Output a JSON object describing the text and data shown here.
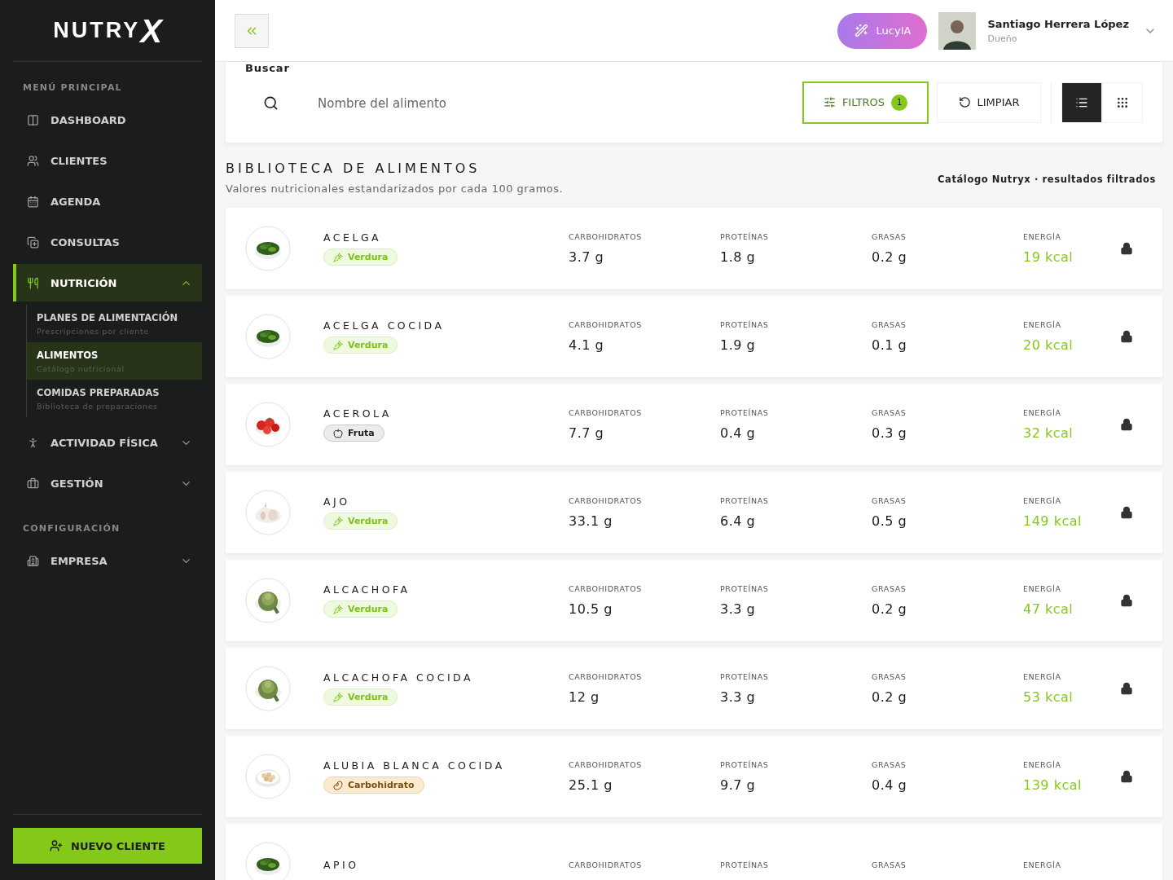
{
  "sidebar": {
    "logo": "NUTRY",
    "logo_mark": "X",
    "sections": [
      {
        "title": "MENÚ PRINCIPAL",
        "items": [
          {
            "label": "DASHBOARD",
            "selected": false
          },
          {
            "label": "CLIENTES",
            "selected": false
          },
          {
            "label": "AGENDA",
            "selected": false
          },
          {
            "label": "CONSULTAS",
            "selected": false
          },
          {
            "label": "NUTRICIÓN",
            "selected": true,
            "expanded": true,
            "children": [
              {
                "label": "PLANES DE ALIMENTACIÓN",
                "subtitle": "Prescripciones por cliente",
                "selected": false
              },
              {
                "label": "ALIMENTOS",
                "subtitle": "Catálogo nutricional",
                "selected": true
              },
              {
                "label": "COMIDAS PREPARADAS",
                "subtitle": "Biblioteca de preparaciones",
                "selected": false
              }
            ]
          },
          {
            "label": "ACTIVIDAD FÍSICA",
            "selected": false,
            "expanded": false
          },
          {
            "label": "GESTIÓN",
            "selected": false,
            "expanded": false
          }
        ]
      },
      {
        "title": "CONFIGURACIÓN",
        "items": [
          {
            "label": "EMPRESA",
            "selected": false,
            "expanded": false
          }
        ]
      }
    ],
    "new_button": "NUEVO CLIENTE"
  },
  "topbar": {
    "assistant": "LucyIA",
    "user": {
      "name": "Santiago Herrera López",
      "role": "Dueño"
    }
  },
  "search": {
    "label": "Buscar",
    "placeholder": "Nombre del alimento",
    "filters": {
      "label": "FILTROS",
      "count": "1"
    },
    "clear": "LIMPIAR",
    "views": [
      {
        "kind": "list",
        "selected": true
      },
      {
        "kind": "grid",
        "selected": false
      }
    ]
  },
  "library": {
    "title": "BIBLIOTECA DE ALIMENTOS",
    "subtitle": "Valores nutricionales estandarizados por cada 100 gramos.",
    "note": "Catálogo Nutryx · resultados filtrados",
    "foods": [
      {
        "name": "ACELGA",
        "tag": {
          "label": "Verdura",
          "kind": "vegetable"
        },
        "locked": true,
        "stats": [
          {
            "label": "CARBOHIDRATOS",
            "value": "3.7 g",
            "kind": "mass"
          },
          {
            "label": "PROTEÍNAS",
            "value": "1.8 g",
            "kind": "mass"
          },
          {
            "label": "GRASAS",
            "value": "0.2 g",
            "kind": "mass"
          },
          {
            "label": "ENERGÍA",
            "value": "19 kcal",
            "kind": "energy"
          }
        ]
      },
      {
        "name": "ACELGA COCIDA",
        "tag": {
          "label": "Verdura",
          "kind": "vegetable"
        },
        "locked": true,
        "stats": [
          {
            "label": "CARBOHIDRATOS",
            "value": "4.1 g",
            "kind": "mass"
          },
          {
            "label": "PROTEÍNAS",
            "value": "1.9 g",
            "kind": "mass"
          },
          {
            "label": "GRASAS",
            "value": "0.1 g",
            "kind": "mass"
          },
          {
            "label": "ENERGÍA",
            "value": "20 kcal",
            "kind": "energy"
          }
        ]
      },
      {
        "name": "ACEROLA",
        "tag": {
          "label": "Fruta",
          "kind": "fruit"
        },
        "locked": true,
        "stats": [
          {
            "label": "CARBOHIDRATOS",
            "value": "7.7 g",
            "kind": "mass"
          },
          {
            "label": "PROTEÍNAS",
            "value": "0.4 g",
            "kind": "mass"
          },
          {
            "label": "GRASAS",
            "value": "0.3 g",
            "kind": "mass"
          },
          {
            "label": "ENERGÍA",
            "value": "32 kcal",
            "kind": "energy"
          }
        ]
      },
      {
        "name": "AJO",
        "tag": {
          "label": "Verdura",
          "kind": "vegetable"
        },
        "locked": true,
        "stats": [
          {
            "label": "CARBOHIDRATOS",
            "value": "33.1 g",
            "kind": "mass"
          },
          {
            "label": "PROTEÍNAS",
            "value": "6.4 g",
            "kind": "mass"
          },
          {
            "label": "GRASAS",
            "value": "0.5 g",
            "kind": "mass"
          },
          {
            "label": "ENERGÍA",
            "value": "149 kcal",
            "kind": "energy"
          }
        ]
      },
      {
        "name": "ALCACHOFA",
        "tag": {
          "label": "Verdura",
          "kind": "vegetable"
        },
        "locked": true,
        "stats": [
          {
            "label": "CARBOHIDRATOS",
            "value": "10.5 g",
            "kind": "mass"
          },
          {
            "label": "PROTEÍNAS",
            "value": "3.3 g",
            "kind": "mass"
          },
          {
            "label": "GRASAS",
            "value": "0.2 g",
            "kind": "mass"
          },
          {
            "label": "ENERGÍA",
            "value": "47 kcal",
            "kind": "energy"
          }
        ]
      },
      {
        "name": "ALCACHOFA COCIDA",
        "tag": {
          "label": "Verdura",
          "kind": "vegetable"
        },
        "locked": true,
        "stats": [
          {
            "label": "CARBOHIDRATOS",
            "value": "12 g",
            "kind": "mass"
          },
          {
            "label": "PROTEÍNAS",
            "value": "3.3 g",
            "kind": "mass"
          },
          {
            "label": "GRASAS",
            "value": "0.2 g",
            "kind": "mass"
          },
          {
            "label": "ENERGÍA",
            "value": "53 kcal",
            "kind": "energy"
          }
        ]
      },
      {
        "name": "ALUBIA BLANCA COCIDA",
        "tag": {
          "label": "Carbohidrato",
          "kind": "carb"
        },
        "locked": true,
        "stats": [
          {
            "label": "CARBOHIDRATOS",
            "value": "25.1 g",
            "kind": "mass"
          },
          {
            "label": "PROTEÍNAS",
            "value": "9.7 g",
            "kind": "mass"
          },
          {
            "label": "GRASAS",
            "value": "0.4 g",
            "kind": "mass"
          },
          {
            "label": "ENERGÍA",
            "value": "139 kcal",
            "kind": "energy"
          }
        ]
      },
      {
        "name": "APIO",
        "locked": false,
        "stats": [
          {
            "label": "CARBOHIDRATOS"
          },
          {
            "label": "PROTEÍNAS"
          },
          {
            "label": "GRASAS"
          },
          {
            "label": "ENERGÍA"
          }
        ]
      }
    ]
  }
}
